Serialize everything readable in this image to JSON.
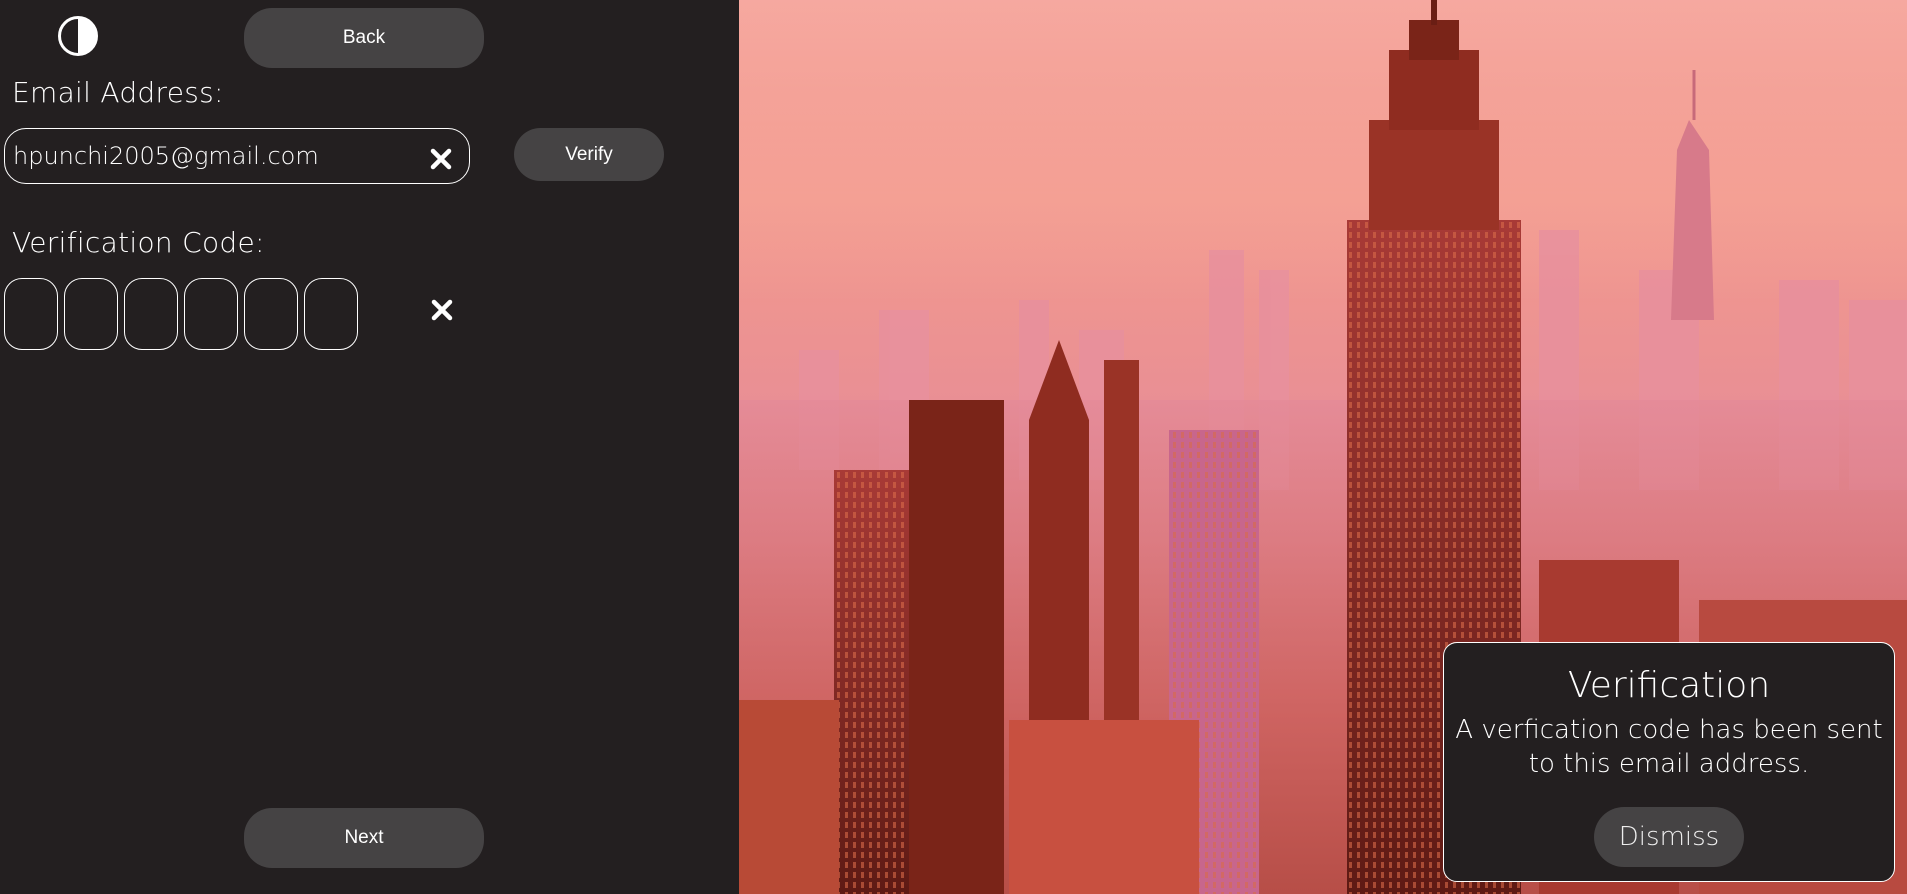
{
  "icons": {
    "theme_toggle": "contrast-icon",
    "clear": "close-icon"
  },
  "header": {
    "back_label": "Back"
  },
  "email": {
    "label": "Email Address:",
    "value": "hpunchi2005@gmail.com",
    "verify_label": "Verify"
  },
  "verification": {
    "label": "Verification Code:",
    "code_digits": [
      "",
      "",
      "",
      "",
      "",
      ""
    ]
  },
  "footer": {
    "next_label": "Next"
  },
  "notice": {
    "title": "Verification",
    "message_line1": "A verfication code has been sent",
    "message_line2": "to this email address.",
    "dismiss_label": "Dismiss"
  },
  "colors": {
    "background": "#231f20",
    "button": "#454344",
    "text": "#ffffff"
  }
}
